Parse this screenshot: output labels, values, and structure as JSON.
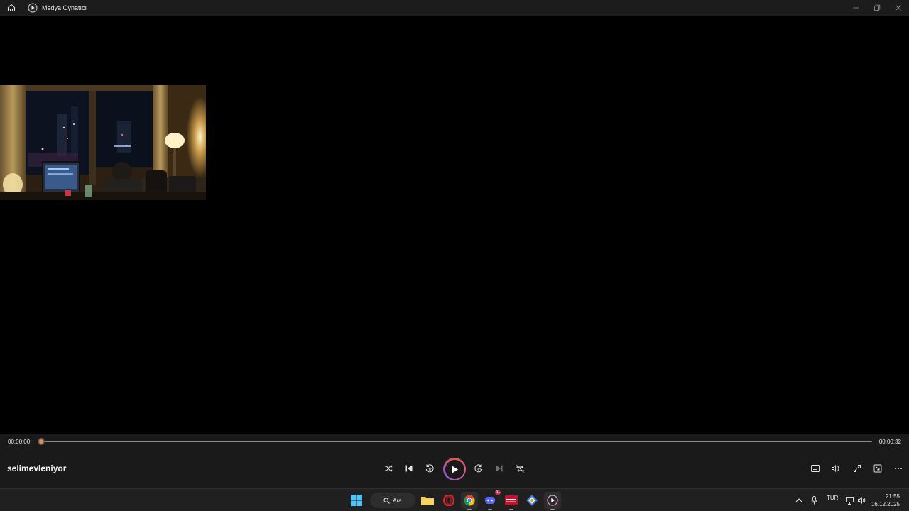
{
  "window": {
    "title": "Medya Oynatıcı"
  },
  "player": {
    "current_time": "00:00:00",
    "total_time": "00:00:32",
    "progress": 0,
    "media_title": "selimevleniyor",
    "accent_color": "#e88b3a"
  },
  "controls": {
    "shuffle": "shuffle-icon",
    "previous": "previous-icon",
    "rewind": "10",
    "play": "play-icon",
    "forward": "30",
    "next": "next-icon",
    "repeat": "repeat-off-icon"
  },
  "right_controls": [
    "subtitles-icon",
    "volume-icon",
    "fullscreen-icon",
    "mini-player-icon",
    "more-icon"
  ],
  "taskbar": {
    "search_label": "Ara",
    "language": "TUR",
    "time": "21:55",
    "date": "16.12.2025",
    "discord_badge": "9+"
  }
}
